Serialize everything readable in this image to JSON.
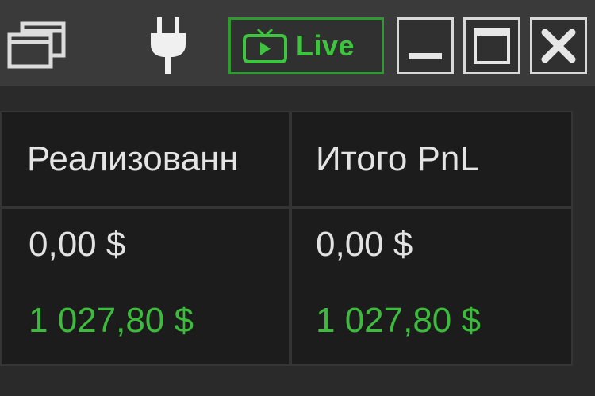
{
  "toolbar": {
    "live_label": "Live",
    "icons": [
      "windows-icon",
      "plug-icon",
      "tv-icon",
      "minimize-icon",
      "maximize-icon",
      "close-icon"
    ],
    "accent_color": "#3ec43e"
  },
  "table": {
    "columns": [
      "Реализованн",
      "Итого PnL"
    ],
    "rows": [
      [
        "0,00 $",
        "0,00 $"
      ],
      [
        "1 027,80 $",
        "1 027,80 $"
      ]
    ],
    "positive_color": "#3cbb3c"
  }
}
